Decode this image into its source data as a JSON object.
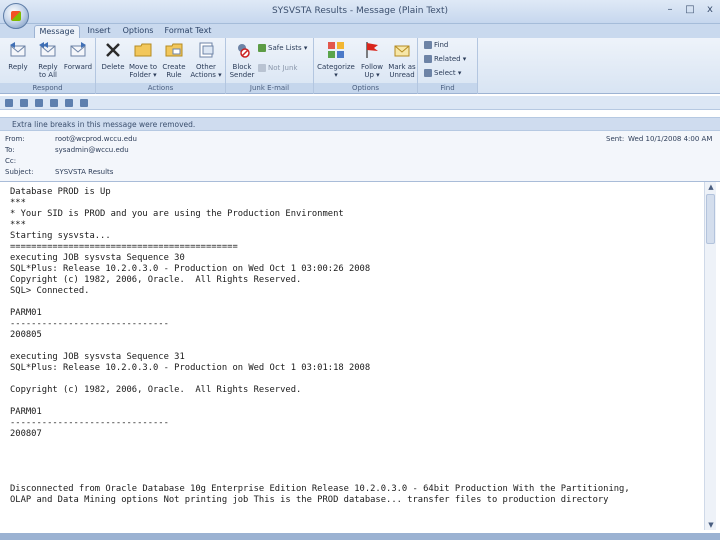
{
  "window": {
    "title": "SYSVSTA Results - Message (Plain Text)",
    "min": "–",
    "max": "□",
    "close": "x"
  },
  "tabs": [
    "Message",
    "Insert",
    "Options",
    "Format Text"
  ],
  "ribbon": {
    "respond": {
      "label": "Respond",
      "reply": "Reply",
      "reply_all": "Reply\nto All",
      "forward": "Forward"
    },
    "actions": {
      "label": "Actions",
      "delete": "Delete",
      "move": "Move to\nFolder ▾",
      "create_rule": "Create\nRule",
      "other": "Other\nActions ▾"
    },
    "junk": {
      "label": "Junk E-mail",
      "block": "Block\nSender",
      "safe_lists": "Safe Lists ▾",
      "not_junk": "Not Junk"
    },
    "options": {
      "label": "Options",
      "categorize": "Categorize\n▾",
      "follow_up": "Follow\nUp ▾",
      "mark_unread": "Mark as\nUnread"
    },
    "find": {
      "label": "Find",
      "find": "Find",
      "related": "Related ▾",
      "select": "Select ▾"
    }
  },
  "infobar": {
    "text": "Extra line breaks in this message were removed."
  },
  "header": {
    "from_label": "From:",
    "from_value": "root@wcprod.wccu.edu",
    "to_label": "To:",
    "to_value": "sysadmin@wccu.edu",
    "cc_label": "Cc:",
    "cc_value": "",
    "subject_label": "Subject:",
    "subject_value": "SYSVSTA Results",
    "sent_label": "Sent:",
    "sent_value": "Wed 10/1/2008 4:00 AM"
  },
  "body_lines": [
    "Database PROD is Up",
    "***",
    "* Your SID is PROD and you are using the Production Environment",
    "***",
    "Starting sysvsta...",
    "===========================================",
    "executing JOB sysvsta Sequence 30",
    "SQL*Plus: Release 10.2.0.3.0 - Production on Wed Oct 1 03:00:26 2008",
    "Copyright (c) 1982, 2006, Oracle.  All Rights Reserved.",
    "SQL> Connected.",
    "",
    "PARM01",
    "------------------------------",
    "200805",
    "",
    "executing JOB sysvsta Sequence 31",
    "SQL*Plus: Release 10.2.0.3.0 - Production on Wed Oct 1 03:01:18 2008",
    "",
    "Copyright (c) 1982, 2006, Oracle.  All Rights Reserved.",
    "",
    "PARM01",
    "------------------------------",
    "200807",
    "",
    "",
    "",
    "",
    "Disconnected from Oracle Database 10g Enterprise Edition Release 10.2.0.3.0 - 64bit Production With the Partitioning,",
    "OLAP and Data Mining options Not printing job This is the PROD database... transfer files to production directory"
  ]
}
